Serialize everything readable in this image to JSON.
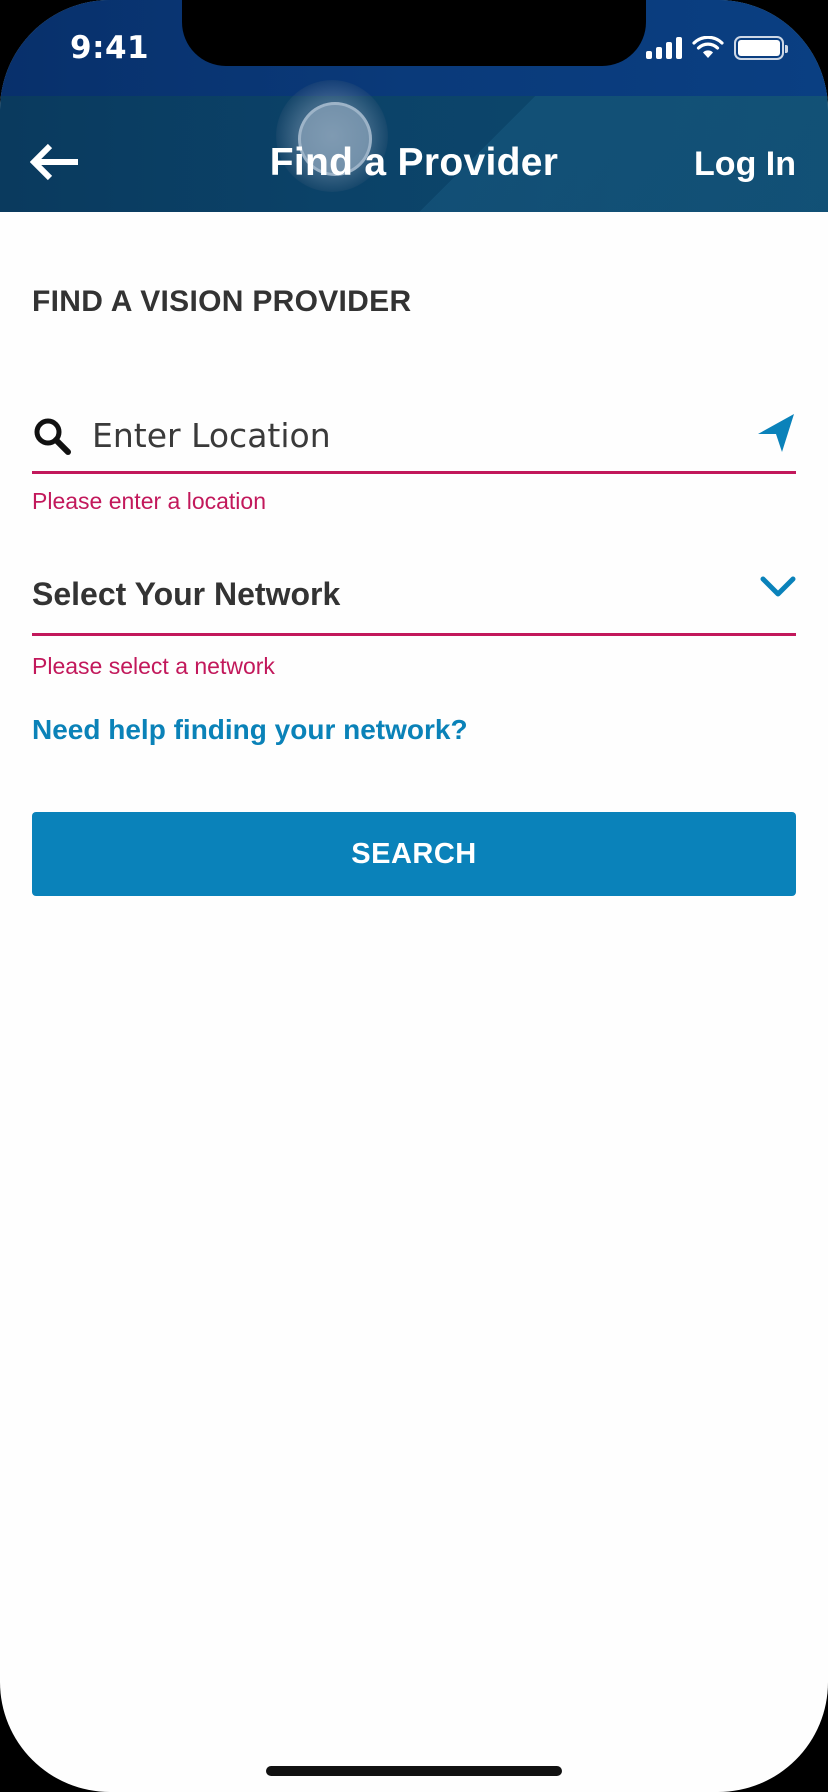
{
  "status_bar": {
    "time": "9:41",
    "signal": "signal-icon",
    "wifi": "wifi-icon",
    "battery": "battery-icon"
  },
  "header": {
    "back_icon": "back-arrow-icon",
    "title": "Find a Provider",
    "login_label": "Log In"
  },
  "main": {
    "section_title": "FIND A VISION PROVIDER",
    "location": {
      "icon": "search-icon",
      "placeholder": "Enter Location",
      "value": "",
      "locate_icon": "location-arrow-icon",
      "error": "Please enter a location"
    },
    "network": {
      "label": "Select Your Network",
      "icon": "chevron-down-icon",
      "error": "Please select a network"
    },
    "help_link": "Need help finding your network?",
    "search_button": "SEARCH"
  },
  "colors": {
    "header_bg": "#0b4268",
    "error": "#c2185b",
    "accent": "#0a82ba",
    "text": "#333333"
  }
}
